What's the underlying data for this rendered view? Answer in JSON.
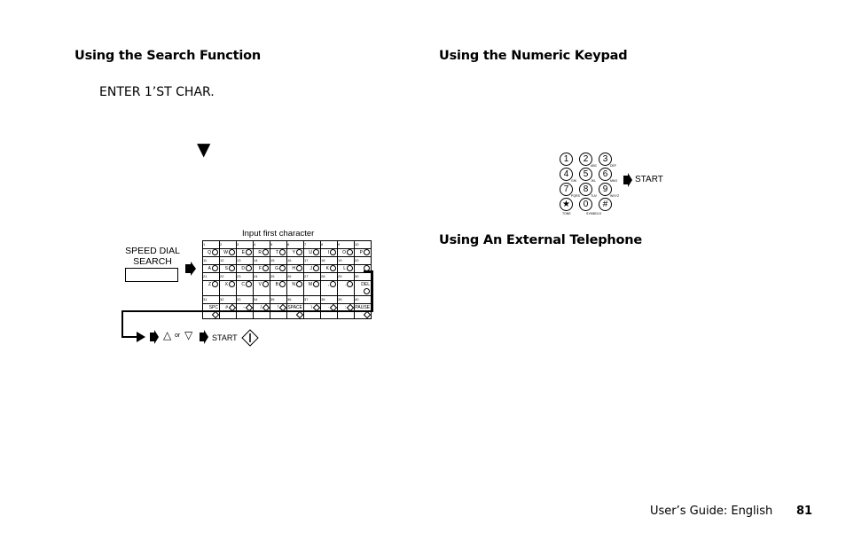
{
  "left": {
    "heading": "Using the Search Function",
    "display_text": "ENTER 1’ST CHAR.",
    "down_arrow": "▼",
    "speed_dial_label_line1": "SPEED DIAL",
    "speed_dial_label_line2": "SEARCH",
    "table_title": "Input first character",
    "rows": [
      {
        "numbers": [
          "1",
          "2",
          "3",
          "4",
          "5",
          "6",
          "7",
          "8",
          "9",
          "10"
        ],
        "chars": [
          "Q",
          "W",
          "E",
          "R",
          "T",
          "Y",
          "U",
          "I",
          "O",
          "P"
        ]
      },
      {
        "numbers": [
          "11",
          "12",
          "13",
          "14",
          "15",
          "16",
          "17",
          "18",
          "19",
          "20"
        ],
        "chars": [
          "A",
          "S",
          "D",
          "F",
          "G",
          "H",
          "J",
          "K",
          "L",
          ""
        ]
      },
      {
        "numbers": [
          "21",
          "22",
          "23",
          "24",
          "25",
          "26",
          "27",
          "28",
          "29",
          "30"
        ],
        "chars": [
          "Z",
          "X",
          "C",
          "V",
          "B",
          "N",
          "M",
          ",",
          ".",
          "DEL"
        ]
      },
      {
        "numbers": [
          "31",
          "32",
          "33",
          "34",
          "35",
          "36",
          "37",
          "38",
          "39",
          "40"
        ],
        "chars": [
          "SPC",
          "#",
          "-",
          "/",
          "!",
          "SPACE",
          "\\",
          "·",
          ":",
          "PAUSE"
        ]
      }
    ],
    "flow_or": "or",
    "flow_start": "START"
  },
  "right": {
    "heading1": "Using the Numeric Keypad",
    "heading2": "Using An External Telephone",
    "keys": [
      "1",
      "2",
      "3",
      "4",
      "5",
      "6",
      "7",
      "8",
      "9",
      "★",
      "0",
      "#"
    ],
    "key_subs": [
      "",
      "ABC",
      "DEF",
      "GHI",
      "JKL",
      "MNO",
      "PQRS",
      "TUV",
      "WXYZ",
      "TONE",
      "SYMBOLS",
      ""
    ],
    "start_label": "START"
  },
  "footer": {
    "guide": "User’s Guide:  English",
    "page": "81"
  }
}
